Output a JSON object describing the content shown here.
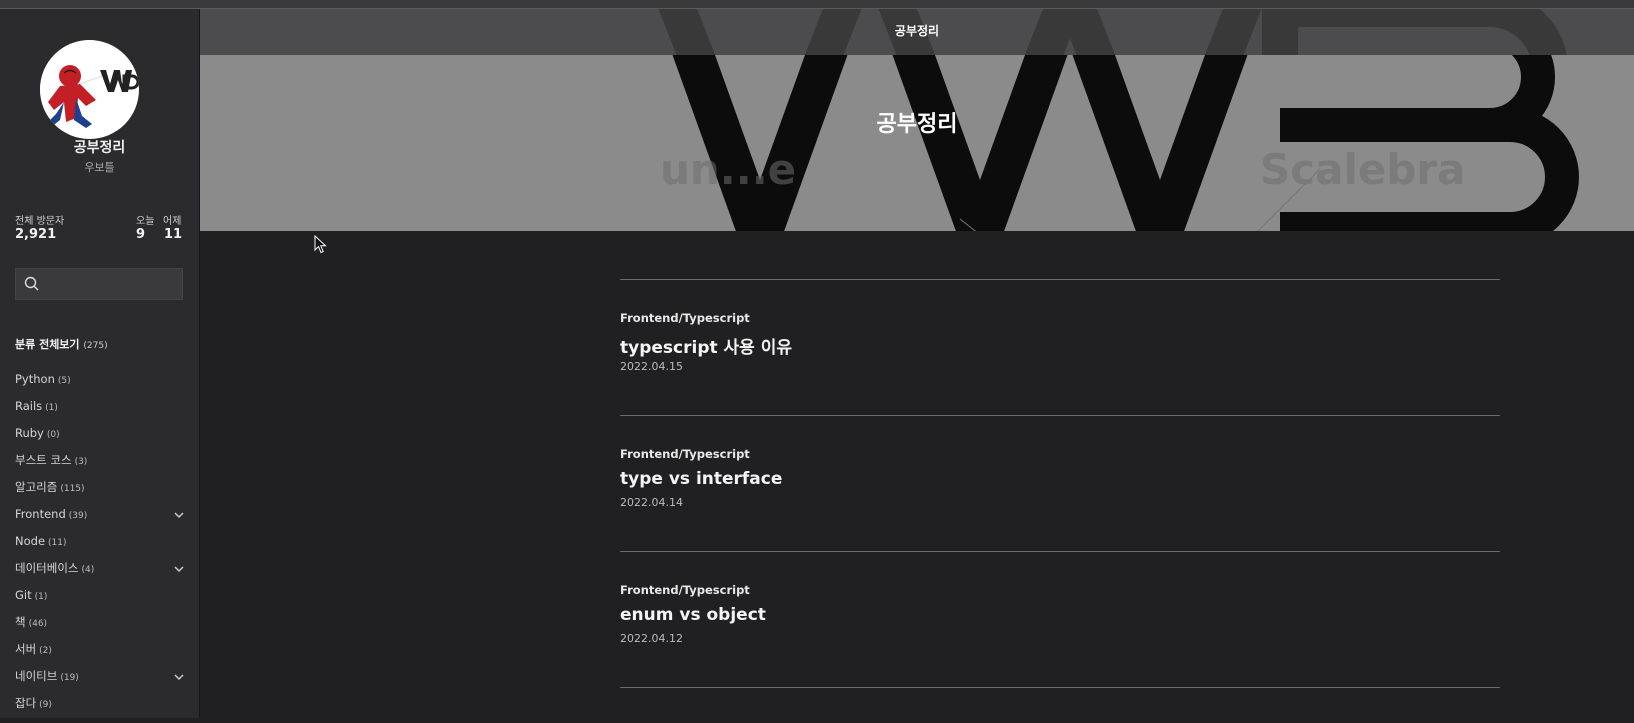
{
  "blog": {
    "name": "공부정리",
    "owner": "우보틀"
  },
  "stats": {
    "total_label": "전체 방문자",
    "total": "2,921",
    "today_label": "오늘",
    "today": "9",
    "yesterday_label": "어제",
    "yesterday": "11"
  },
  "search": {
    "placeholder": ""
  },
  "categories": {
    "all_label": "분류 전체보기",
    "all_count": "(275)",
    "items": [
      {
        "label": "Python",
        "count": "(5)"
      },
      {
        "label": "Rails",
        "count": "(1)"
      },
      {
        "label": "Ruby",
        "count": "(0)"
      },
      {
        "label": "부스트 코스",
        "count": "(3)"
      },
      {
        "label": "알고리즘",
        "count": "(115)"
      },
      {
        "label": "Frontend",
        "count": "(39)"
      },
      {
        "label": "Node",
        "count": "(11)"
      },
      {
        "label": "데이터베이스",
        "count": "(4)"
      },
      {
        "label": "Git",
        "count": "(1)"
      },
      {
        "label": "책",
        "count": "(46)"
      },
      {
        "label": "서버",
        "count": "(2)"
      },
      {
        "label": "네이티브",
        "count": "(19)"
      },
      {
        "label": "잡다",
        "count": "(9)"
      }
    ]
  },
  "header": {
    "title": "공부정리"
  },
  "hero": {
    "title": "공부정리"
  },
  "posts": [
    {
      "category": "Frontend/Typescript",
      "title": "typescript 사용 이유",
      "date": "2022.04.15"
    },
    {
      "category": "Frontend/Typescript",
      "title": "type vs interface",
      "date": "2022.04.14"
    },
    {
      "category": "Frontend/Typescript",
      "title": "enum vs object",
      "date": "2022.04.12"
    }
  ],
  "icons": [
    "search-icon",
    "chevron-down-icon",
    "mouse-cursor-icon"
  ]
}
